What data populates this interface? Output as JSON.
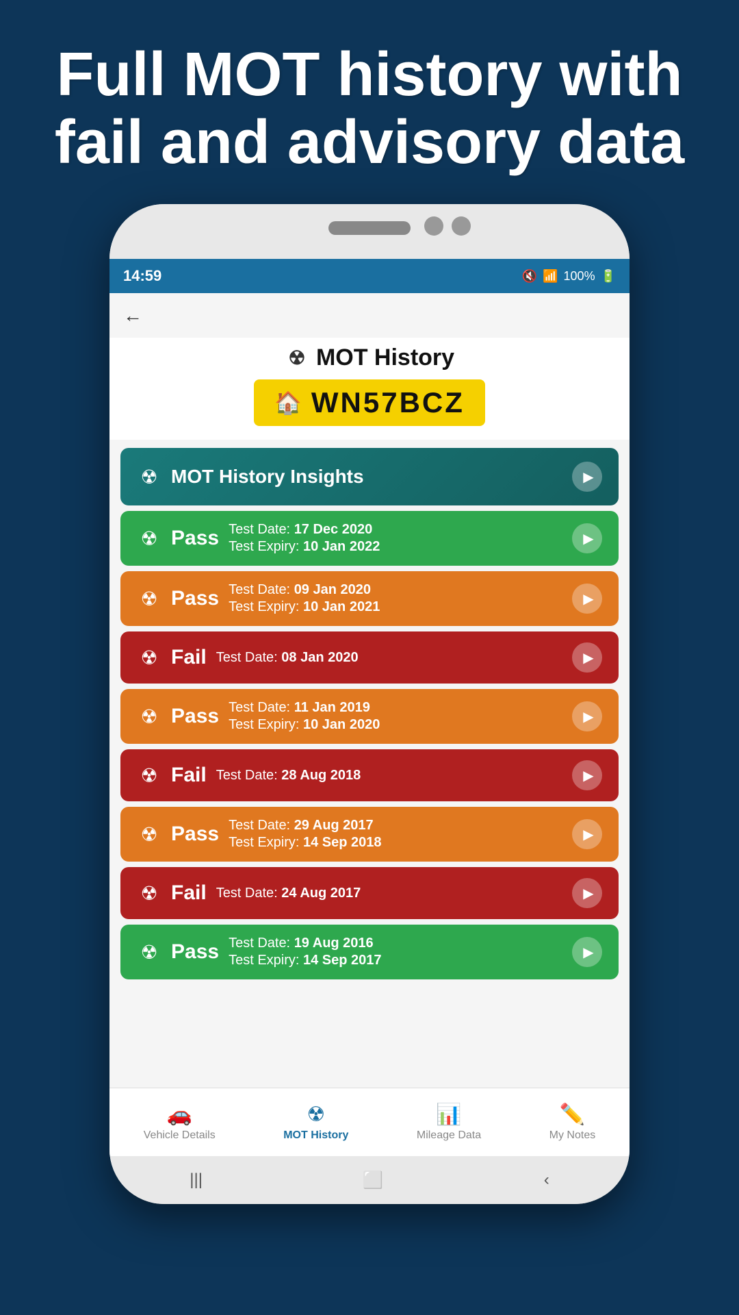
{
  "page": {
    "header": "Full MOT history with fail and advisory data",
    "background_color": "#0d3558"
  },
  "status_bar": {
    "time": "14:59",
    "battery": "100%"
  },
  "app_title": "MOT History",
  "plate": {
    "text": "WN57BCZ"
  },
  "insights_banner": {
    "label": "MOT History Insights"
  },
  "mot_records": [
    {
      "status": "Pass",
      "color_class": "row-pass-green",
      "test_date_label": "Test Date:",
      "test_date_value": "17 Dec 2020",
      "expiry_label": "Test Expiry:",
      "expiry_value": "10 Jan 2022",
      "has_expiry": true
    },
    {
      "status": "Pass",
      "color_class": "row-pass-orange",
      "test_date_label": "Test Date:",
      "test_date_value": "09 Jan 2020",
      "expiry_label": "Test Expiry:",
      "expiry_value": "10 Jan 2021",
      "has_expiry": true
    },
    {
      "status": "Fail",
      "color_class": "row-fail",
      "test_date_label": "Test Date:",
      "test_date_value": "08 Jan 2020",
      "expiry_label": "",
      "expiry_value": "",
      "has_expiry": false
    },
    {
      "status": "Pass",
      "color_class": "row-pass-orange",
      "test_date_label": "Test Date:",
      "test_date_value": "11 Jan 2019",
      "expiry_label": "Test Expiry:",
      "expiry_value": "10 Jan 2020",
      "has_expiry": true
    },
    {
      "status": "Fail",
      "color_class": "row-fail",
      "test_date_label": "Test Date:",
      "test_date_value": "28 Aug 2018",
      "expiry_label": "",
      "expiry_value": "",
      "has_expiry": false
    },
    {
      "status": "Pass",
      "color_class": "row-pass-orange",
      "test_date_label": "Test Date:",
      "test_date_value": "29 Aug 2017",
      "expiry_label": "Test Expiry:",
      "expiry_value": "14 Sep 2018",
      "has_expiry": true
    },
    {
      "status": "Fail",
      "color_class": "row-fail",
      "test_date_label": "Test Date:",
      "test_date_value": "24 Aug 2017",
      "expiry_label": "",
      "expiry_value": "",
      "has_expiry": false
    },
    {
      "status": "Pass",
      "color_class": "row-pass-green",
      "test_date_label": "Test Date:",
      "test_date_value": "19 Aug 2016",
      "expiry_label": "Test Expiry:",
      "expiry_value": "14 Sep 2017",
      "has_expiry": true
    }
  ],
  "bottom_nav": {
    "items": [
      {
        "label": "Vehicle Details",
        "icon": "🚗",
        "active": false
      },
      {
        "label": "MOT History",
        "icon": "☢",
        "active": true
      },
      {
        "label": "Mileage Data",
        "icon": "📊",
        "active": false
      },
      {
        "label": "My Notes",
        "icon": "✏️",
        "active": false
      }
    ]
  }
}
